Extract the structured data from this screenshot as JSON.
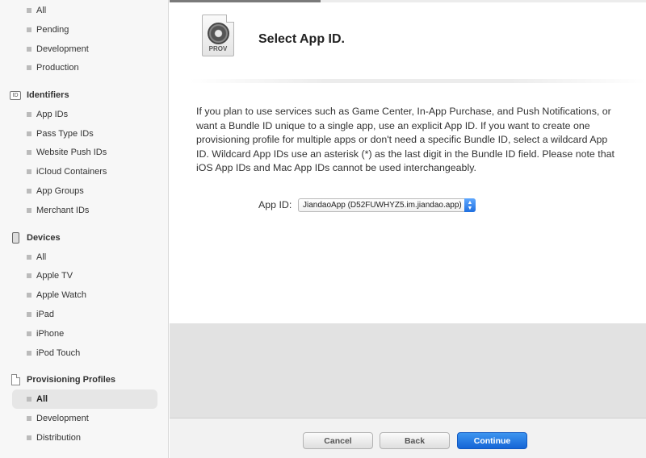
{
  "sidebar": {
    "certificates_items": [
      "All",
      "Pending",
      "Development",
      "Production"
    ],
    "identifiers": {
      "icon_text": "ID",
      "title": "Identifiers",
      "items": [
        "App IDs",
        "Pass Type IDs",
        "Website Push IDs",
        "iCloud Containers",
        "App Groups",
        "Merchant IDs"
      ]
    },
    "devices": {
      "title": "Devices",
      "items": [
        "All",
        "Apple TV",
        "Apple Watch",
        "iPad",
        "iPhone",
        "iPod Touch"
      ]
    },
    "profiles": {
      "title": "Provisioning Profiles",
      "items": [
        "All",
        "Development",
        "Distribution"
      ],
      "selected": "All"
    }
  },
  "header": {
    "file_label": "PROV",
    "title": "Select App ID."
  },
  "description": "If you plan to use services such as Game Center, In-App Purchase, and Push Notifications, or want a Bundle ID unique to a single app, use an explicit App ID. If you want to create one provisioning profile for multiple apps or don't need a specific Bundle ID, select a wildcard App ID. Wildcard App IDs use an asterisk (*) as the last digit in the Bundle ID field. Please note that iOS App IDs and Mac App IDs cannot be used interchangeably.",
  "form": {
    "app_id_label": "App ID:",
    "app_id_value": "JiandaoApp (D52FUWHYZ5.im.jiandao.app)"
  },
  "footer": {
    "cancel": "Cancel",
    "back": "Back",
    "continue": "Continue"
  },
  "colors": {
    "primary": "#1f6fe0",
    "sidebar_bg": "#f7f7f7"
  }
}
